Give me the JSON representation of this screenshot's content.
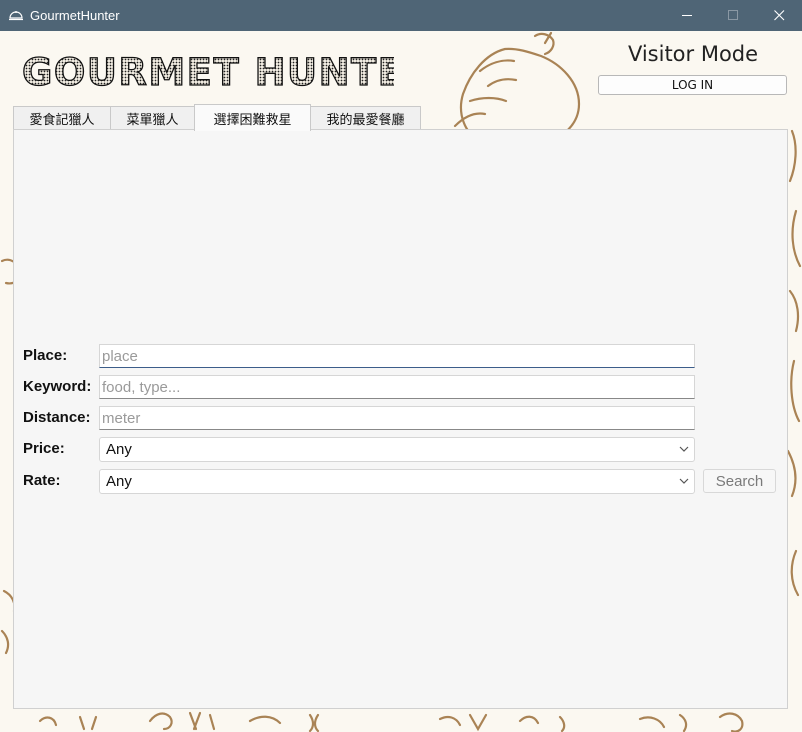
{
  "window": {
    "title": "GourmetHunter",
    "titlebar_color": "#4f6576"
  },
  "header": {
    "logo_text": "GOURMET HUNTER",
    "mode_label": "Visitor Mode",
    "login_label": "LOG IN"
  },
  "tabs": [
    {
      "label": "愛食記獵人",
      "active": false
    },
    {
      "label": "菜單獵人",
      "active": false
    },
    {
      "label": "選擇困難救星",
      "active": true
    },
    {
      "label": "我的最愛餐廳",
      "active": false
    }
  ],
  "form": {
    "place": {
      "label": "Place:",
      "placeholder": "place",
      "value": ""
    },
    "keyword": {
      "label": "Keyword:",
      "placeholder": "food, type...",
      "value": ""
    },
    "distance": {
      "label": "Distance:",
      "placeholder": "meter",
      "value": ""
    },
    "price": {
      "label": "Price:",
      "selected": "Any"
    },
    "rate": {
      "label": "Rate:",
      "selected": "Any"
    },
    "search_label": "Search"
  },
  "icons": {
    "app": "restaurant-icon",
    "minimize": "minimize-icon",
    "maximize": "maximize-icon",
    "close": "close-icon",
    "dropdown": "chevron-down-icon"
  }
}
